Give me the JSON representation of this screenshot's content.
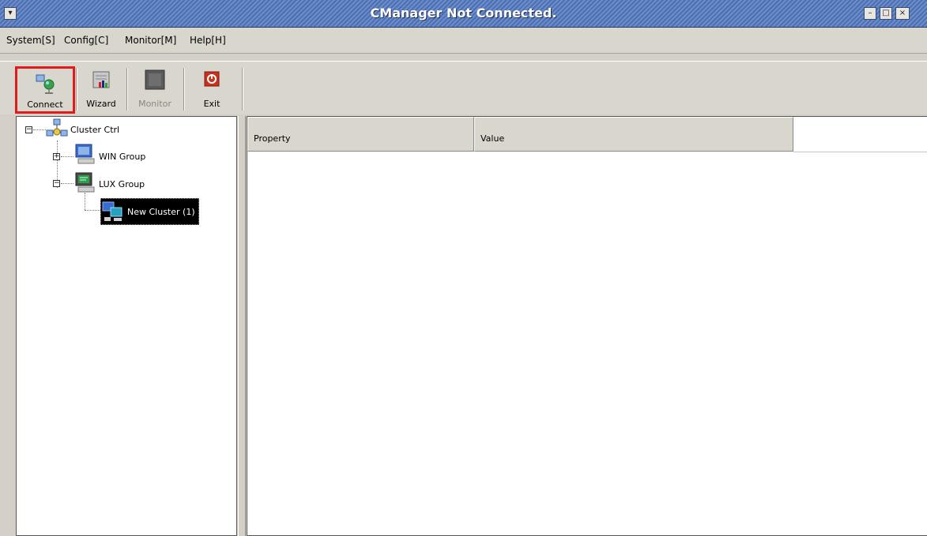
{
  "window": {
    "title": "CManager Not Connected.",
    "controls": {
      "menu": "▾",
      "minimize": "–",
      "maximize": "□",
      "close": "×"
    }
  },
  "menubar": {
    "items": [
      "System[S]",
      "Config[C]",
      "Monitor[M]",
      "Help[H]"
    ]
  },
  "toolbar": {
    "connect_label": "Connect",
    "wizard_label": "Wizard",
    "monitor_label": "Monitor",
    "exit_label": "Exit",
    "highlight_color": "#e01b1b"
  },
  "tree": {
    "root": {
      "label": "Cluster Ctrl",
      "expander": "−"
    },
    "children": [
      {
        "label": "WIN Group",
        "expander": "+"
      },
      {
        "label": "LUX Group",
        "expander": "−"
      }
    ],
    "selected_leaf": {
      "label": "New Cluster (1)"
    }
  },
  "table": {
    "columns": [
      "Property",
      "Value"
    ],
    "rows": []
  }
}
